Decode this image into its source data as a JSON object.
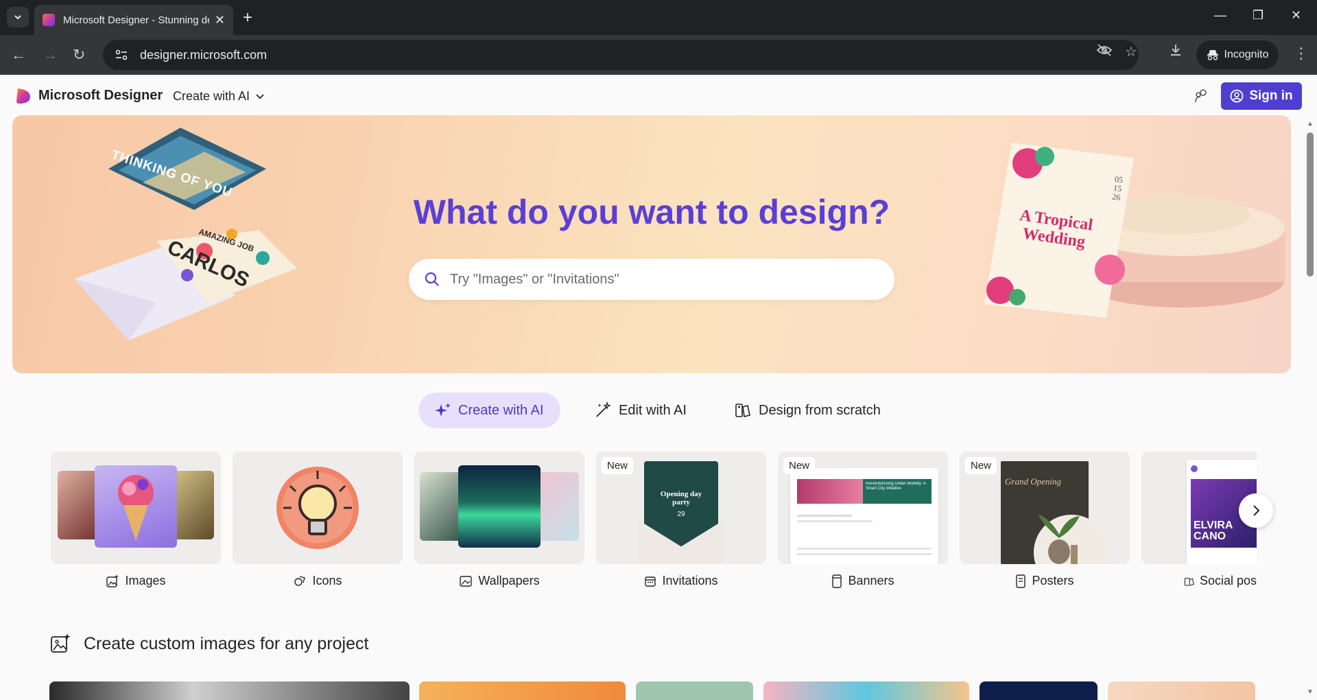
{
  "browser": {
    "tab_title": "Microsoft Designer - Stunning designs in a flash",
    "url": "designer.microsoft.com",
    "incognito_label": "Incognito"
  },
  "header": {
    "brand": "Microsoft Designer",
    "create_menu": "Create with AI",
    "signin": "Sign in"
  },
  "hero": {
    "title": "What do you want to design?",
    "search_placeholder": "Try \"Images\" or \"Invitations\"",
    "cards": {
      "thinking": "THINKING OF YOU",
      "amazing": "AMAZING JOB",
      "carlos": "CARLOS",
      "wedding_title": "A Tropical Wedding",
      "wedding_date": "05 15 26"
    }
  },
  "modes": [
    {
      "label": "Create with AI"
    },
    {
      "label": "Edit with AI"
    },
    {
      "label": "Design from scratch"
    }
  ],
  "categories": [
    {
      "label": "Images",
      "badge": ""
    },
    {
      "label": "Icons",
      "badge": ""
    },
    {
      "label": "Wallpapers",
      "badge": ""
    },
    {
      "label": "Invitations",
      "badge": "New",
      "card_text": "Opening day party",
      "card_day": "29"
    },
    {
      "label": "Banners",
      "badge": "New",
      "card_text": "Revolutionizing Urban Mobility: A Smart City Initiative"
    },
    {
      "label": "Posters",
      "badge": "New",
      "card_text": "Grand Opening"
    },
    {
      "label": "Social pos",
      "badge": "",
      "card_text": "ELVIRA CANO"
    }
  ],
  "section": {
    "title": "Create custom images for any project"
  }
}
